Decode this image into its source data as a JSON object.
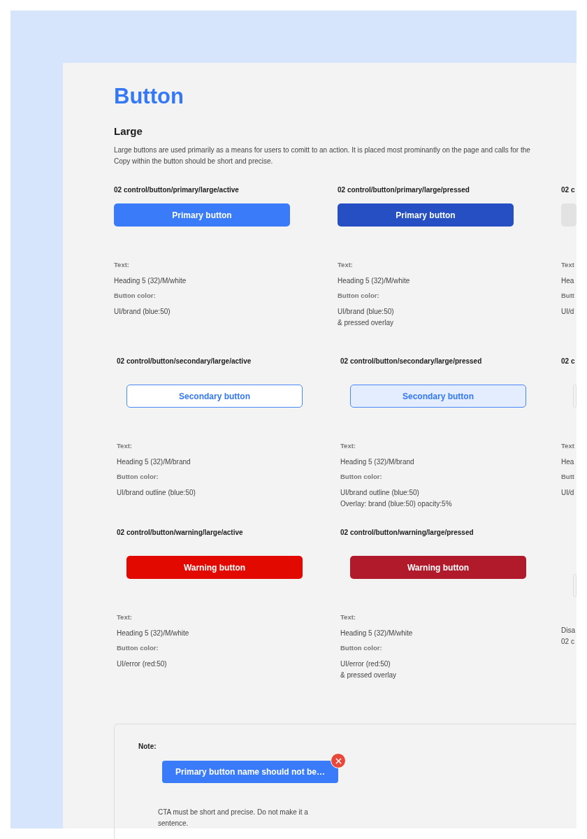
{
  "page": {
    "title": "Button"
  },
  "section": {
    "heading": "Large",
    "description_lines": [
      "Large buttons are used primarily as a means for users to comitt to an action. It is placed most prominantly on the page and calls for the",
      "Copy within the button should be short and precise."
    ]
  },
  "rows": [
    {
      "cells": [
        {
          "title": "02 control/button/primary/large/active",
          "button": {
            "kind": "primary",
            "pressed": false,
            "label": "Primary button"
          },
          "specs": [
            {
              "label": "Text:",
              "lines": [
                "Heading 5 (32)/M/white"
              ]
            },
            {
              "label": "Button color:",
              "lines": [
                "UI/brand (blue:50)"
              ]
            }
          ]
        },
        {
          "title": "02 control/button/primary/large/pressed",
          "button": {
            "kind": "primary",
            "pressed": true,
            "label": "Primary button"
          },
          "specs": [
            {
              "label": "Text:",
              "lines": [
                "Heading 5 (32)/M/white"
              ]
            },
            {
              "label": "Button color:",
              "lines": [
                "UI/brand (blue:50)",
                "& pressed overlay"
              ]
            }
          ]
        },
        {
          "title": "02 c",
          "button": {
            "kind": "disabled"
          },
          "specs": [
            {
              "label": "Text",
              "lines": [
                "Hea"
              ]
            },
            {
              "label": "Butt",
              "lines": [
                "UI/d"
              ]
            }
          ]
        }
      ]
    },
    {
      "cells": [
        {
          "title": "02 control/button/secondary/large/active",
          "button": {
            "kind": "secondary",
            "pressed": false,
            "label": "Secondary button"
          },
          "specs": [
            {
              "label": "Text:",
              "lines": [
                "Heading 5 (32)/M/brand"
              ]
            },
            {
              "label": "Button color:",
              "lines": [
                "UI/brand outline (blue:50)"
              ]
            }
          ]
        },
        {
          "title": "02 control/button/secondary/large/pressed",
          "button": {
            "kind": "secondary",
            "pressed": true,
            "label": "Secondary button"
          },
          "specs": [
            {
              "label": "Text:",
              "lines": [
                "Heading 5 (32)/M/brand"
              ]
            },
            {
              "label": "Button color:",
              "lines": [
                "UI/brand outline (blue:50)",
                "Overlay: brand (blue:50) opacity:5%"
              ]
            }
          ]
        },
        {
          "title": "02 c",
          "button": {
            "kind": "outline"
          },
          "specs": [
            {
              "label": "Text",
              "lines": [
                "Hea"
              ]
            },
            {
              "label": "Butt",
              "lines": [
                "UI/d"
              ]
            }
          ]
        }
      ]
    },
    {
      "cells": [
        {
          "title": "02 control/button/warning/large/active",
          "button": {
            "kind": "warning",
            "pressed": false,
            "label": "Warning button"
          },
          "specs": [
            {
              "label": "Text:",
              "lines": [
                "Heading 5 (32)/M/white"
              ]
            },
            {
              "label": "Button color:",
              "lines": [
                "UI/error (red:50)"
              ]
            }
          ]
        },
        {
          "title": "02 control/button/warning/large/pressed",
          "button": {
            "kind": "warning",
            "pressed": true,
            "label": "Warning button"
          },
          "specs": [
            {
              "label": "Text:",
              "lines": [
                "Heading 5 (32)/M/white"
              ]
            },
            {
              "label": "Button color:",
              "lines": [
                "UI/error (red:50)",
                "& pressed overlay"
              ]
            }
          ]
        },
        {
          "button": {
            "kind": "outline"
          },
          "notes": [
            "Disa",
            "02 c"
          ]
        }
      ]
    }
  ],
  "note": {
    "label": "Note:",
    "example_button": {
      "label": "Primary button name should not be…",
      "rejected": true
    },
    "text": "CTA must be short and precise. Do not make it a sentence."
  }
}
